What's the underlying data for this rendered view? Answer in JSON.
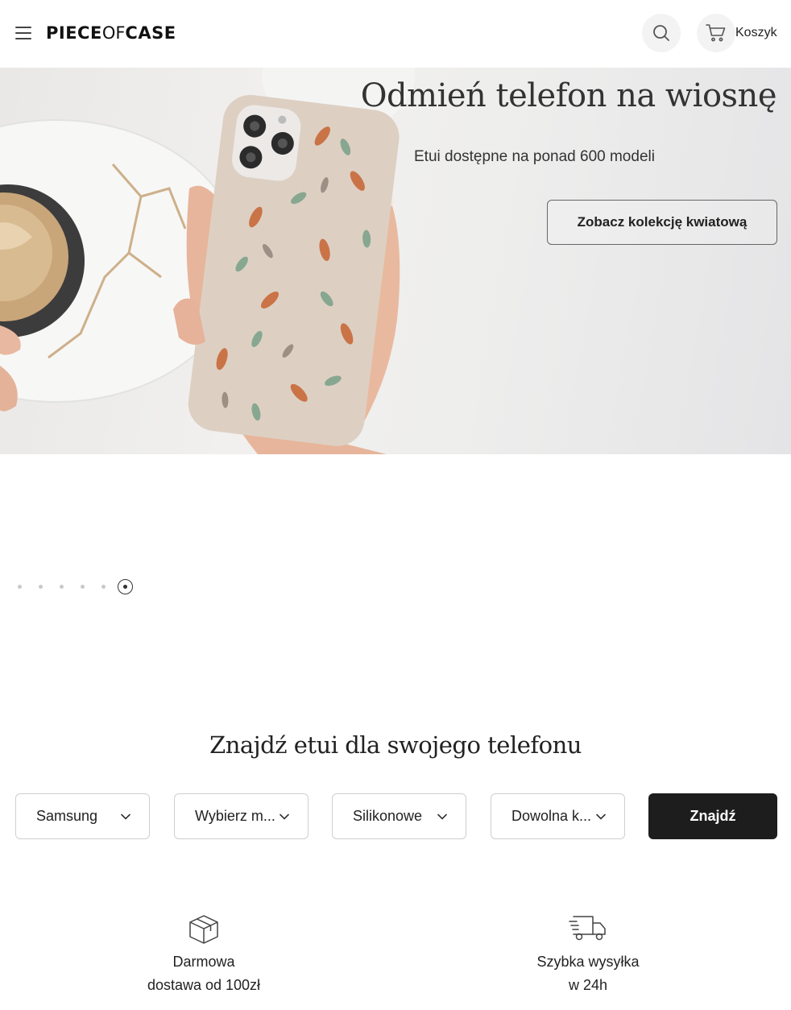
{
  "header": {
    "logo": {
      "part1": "PIECE",
      "part2": "OF",
      "part3": "CASE"
    },
    "cart_label": "Koszyk",
    "icons": {
      "menu": "menu-icon",
      "search": "search-icon",
      "cart": "cart-icon"
    }
  },
  "hero": {
    "title": "Odmień telefon na wiosnę",
    "subtitle": "Etui dostępne na ponad 600 modeli",
    "cta_label": "Zobacz kolekcję kwiatową"
  },
  "carousel": {
    "slide_count": 6,
    "active_index": 5
  },
  "finder": {
    "title": "Znajdź etui dla swojego telefonu",
    "brand_value": "Samsung",
    "model_value": "Wybierz m...",
    "type_value": "Silikonowe",
    "color_value": "Dowolna k...",
    "submit_label": "Znajdź"
  },
  "features": [
    {
      "icon": "package-icon",
      "line1": "Darmowa",
      "line2": "dostawa od 100zł"
    },
    {
      "icon": "delivery-truck-icon",
      "line1": "Szybka wysyłka",
      "line2": "w 24h"
    }
  ],
  "colors": {
    "primary_button": "#1d1d1d",
    "border": "#cfcfcf",
    "text": "#222222"
  }
}
